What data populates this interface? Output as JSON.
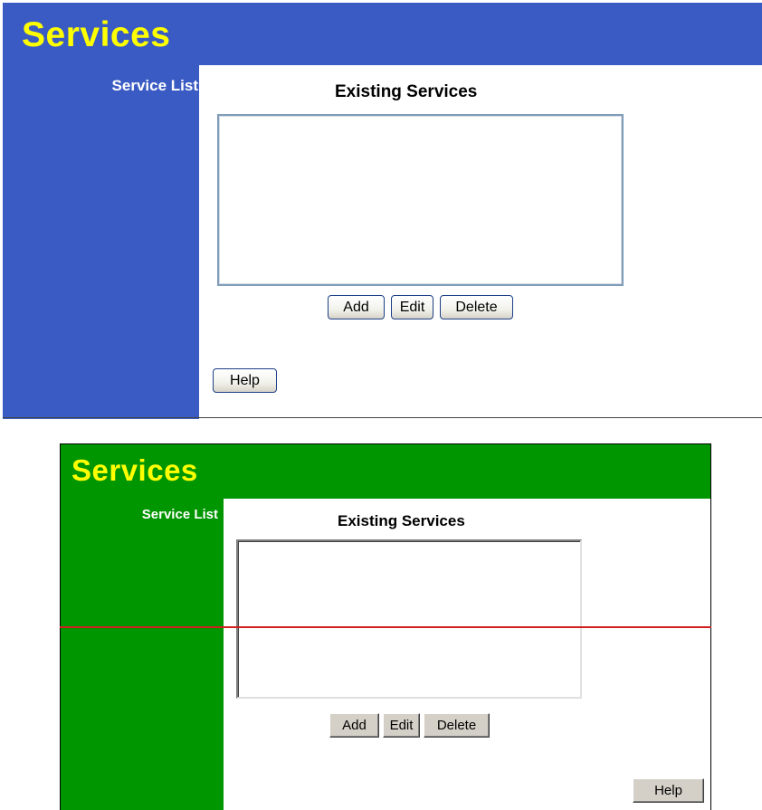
{
  "panel_blue": {
    "title": "Services",
    "sidebar_label": "Service List",
    "heading": "Existing Services",
    "buttons": {
      "add": "Add",
      "edit": "Edit",
      "delete": "Delete",
      "help": "Help"
    },
    "colors": {
      "banner": "#3b5bc4",
      "title": "#ffff00"
    }
  },
  "panel_green": {
    "title": "Services",
    "sidebar_label": "Service List",
    "heading": "Existing Services",
    "buttons": {
      "add": "Add",
      "edit": "Edit",
      "delete": "Delete",
      "help": "Help"
    },
    "colors": {
      "banner": "#009600",
      "title": "#ffff00",
      "divider": "#d02020"
    }
  }
}
